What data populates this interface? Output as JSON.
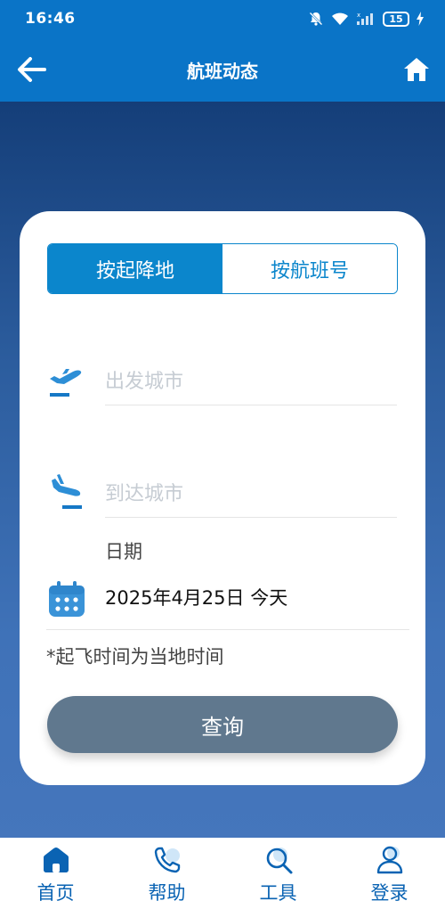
{
  "status_bar": {
    "time": "16:46",
    "battery": "15"
  },
  "header": {
    "title": "航班动态"
  },
  "tabs": [
    {
      "label": "按起降地",
      "active": true
    },
    {
      "label": "按航班号",
      "active": false
    }
  ],
  "form": {
    "departure_placeholder": "出发城市",
    "arrival_placeholder": "到达城市",
    "date_label": "日期",
    "date_value": "2025年4月25日 今天",
    "note": "*起飞时间为当地时间",
    "query_label": "查询"
  },
  "bottom_nav": [
    {
      "label": "首页",
      "icon": "home-icon"
    },
    {
      "label": "帮助",
      "icon": "phone-icon"
    },
    {
      "label": "工具",
      "icon": "search-icon"
    },
    {
      "label": "登录",
      "icon": "user-icon"
    }
  ],
  "colors": {
    "primary": "#0a74c7",
    "tab_active": "#0b86cc",
    "button": "#60788e",
    "nav_label": "#0a63b3"
  }
}
